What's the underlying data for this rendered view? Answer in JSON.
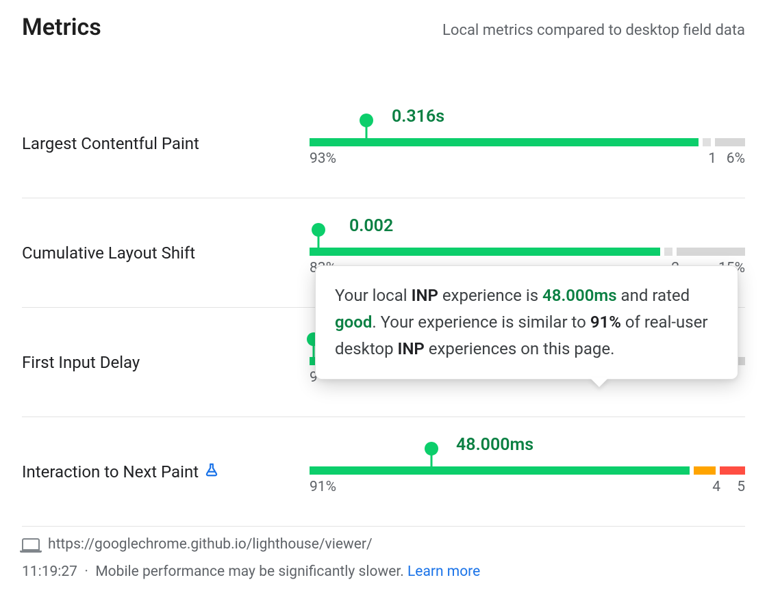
{
  "header": {
    "title": "Metrics",
    "subtitle": "Local metrics compared to desktop field data"
  },
  "metrics": [
    {
      "id": "lcp",
      "label": "Largest Contentful Paint",
      "value": "0.316s",
      "marker_pct": 13,
      "segments": {
        "good": 93,
        "ni": 1,
        "poor": 6
      },
      "colored_tail": false
    },
    {
      "id": "cls",
      "label": "Cumulative Layout Shift",
      "value": "0.002",
      "marker_pct": 2,
      "segments": {
        "good": 83,
        "ni": 2,
        "poor": 15
      },
      "colored_tail": false
    },
    {
      "id": "fid",
      "label": "First Input Delay",
      "value": "",
      "marker_pct": 0,
      "segments": {
        "good": 9,
        "ni": 0,
        "poor": 0
      },
      "colored_tail": false
    },
    {
      "id": "inp",
      "label": "Interaction to Next Paint",
      "experimental": true,
      "value": "48.000ms",
      "marker_pct": 28,
      "segments": {
        "good": 91,
        "ni": 4,
        "poor": 5
      },
      "colored_tail": true
    }
  ],
  "tooltip": {
    "text_pre": "Your local ",
    "abbr1": "INP",
    "text_mid1": " experience is ",
    "value": "48.000ms",
    "text_mid2": " and rated ",
    "rating": "good",
    "text_mid3": ". Your experience is similar to ",
    "percent": "91%",
    "text_mid4": " of real-user desktop ",
    "abbr2": "INP",
    "text_end": " experiences on this page."
  },
  "footer": {
    "url": "https://googlechrome.github.io/lighthouse/viewer/",
    "time": "11:19:27",
    "dot": "·",
    "note": "Mobile performance may be significantly slower.",
    "learn_more": "Learn more"
  },
  "chart_data": {
    "type": "bar",
    "title": "Local metrics compared to desktop field data",
    "series": [
      {
        "name": "Largest Contentful Paint",
        "local_value": "0.316s",
        "distribution_pct": {
          "good": 93,
          "needs_improvement": 1,
          "poor": 6
        }
      },
      {
        "name": "Cumulative Layout Shift",
        "local_value": "0.002",
        "distribution_pct": {
          "good": 83,
          "needs_improvement": 2,
          "poor": 15
        }
      },
      {
        "name": "First Input Delay",
        "local_value": null,
        "distribution_pct": null
      },
      {
        "name": "Interaction to Next Paint",
        "local_value": "48.000ms",
        "distribution_pct": {
          "good": 91,
          "needs_improvement": 4,
          "poor": 5
        }
      }
    ]
  }
}
